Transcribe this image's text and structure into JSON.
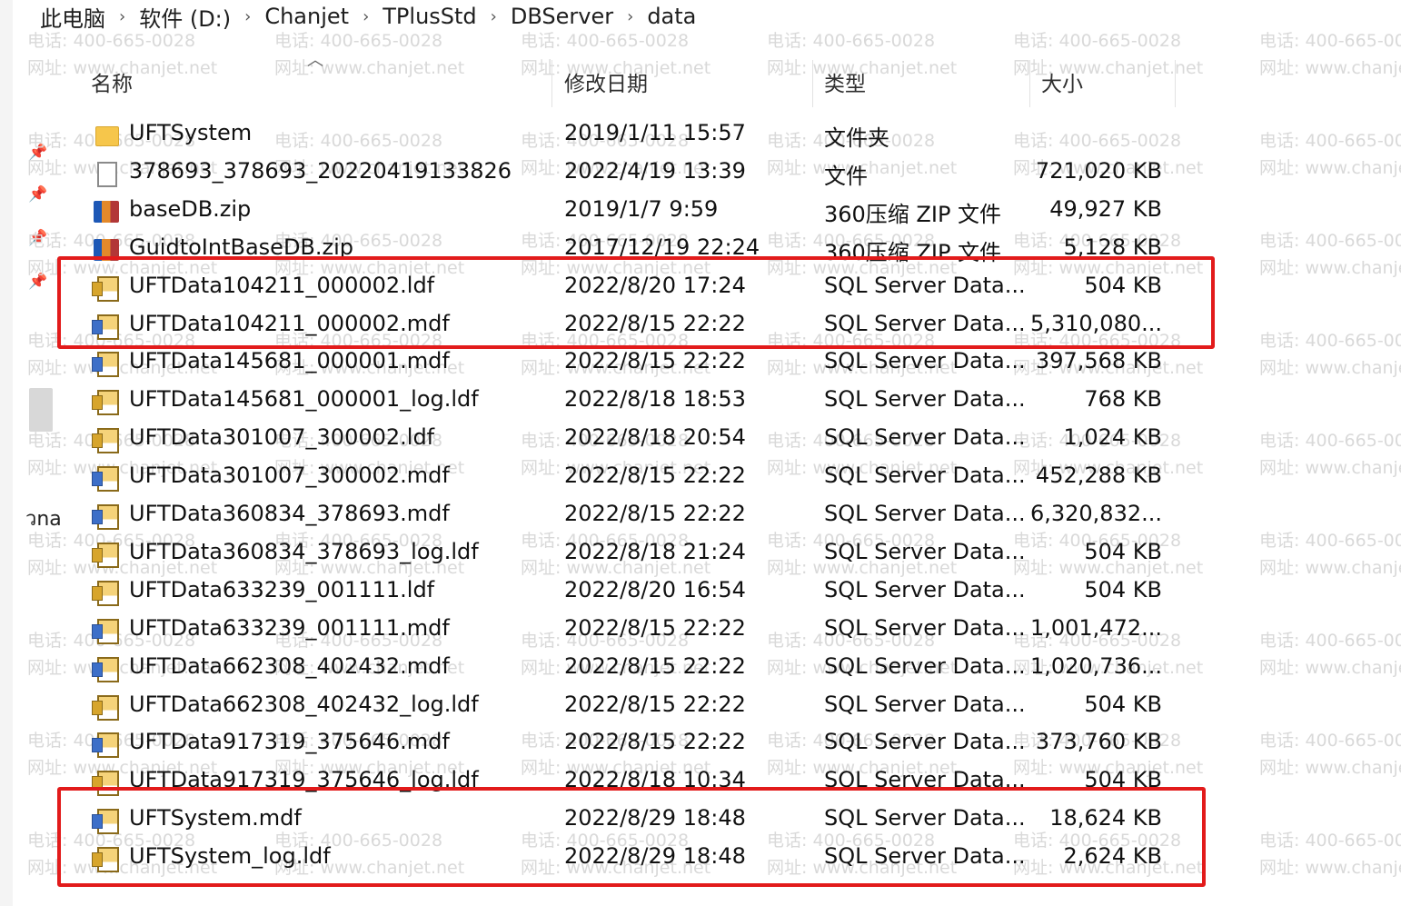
{
  "breadcrumb": [
    "此电脑",
    "软件 (D:)",
    "Chanjet",
    "TPlusStd",
    "DBServer",
    "data"
  ],
  "columns": {
    "name": "名称",
    "date": "修改日期",
    "type": "类型",
    "size": "大小"
  },
  "watermark": {
    "phone": "电话: 400-665-0028",
    "site": "网址: www.chanjet.net"
  },
  "side_text": "วna",
  "files": [
    {
      "icon": "folder-icon",
      "name": "UFTSystem",
      "date": "2019/1/11 15:57",
      "type": "文件夹",
      "size": ""
    },
    {
      "icon": "file-icon",
      "name": "378693_378693_20220419133826",
      "date": "2022/4/19 13:39",
      "type": "文件",
      "size": "721,020 KB"
    },
    {
      "icon": "zip-icon",
      "name": "baseDB.zip",
      "date": "2019/1/7 9:59",
      "type": "360压缩 ZIP 文件",
      "size": "49,927 KB"
    },
    {
      "icon": "zip-icon",
      "name": "GuidtoIntBaseDB.zip",
      "date": "2017/12/19 22:24",
      "type": "360压缩 ZIP 文件",
      "size": "5,128 KB"
    },
    {
      "icon": "ldf-icon",
      "name": "UFTData104211_000002.ldf",
      "date": "2022/8/20 17:24",
      "type": "SQL Server Data...",
      "size": "504 KB"
    },
    {
      "icon": "mdf-icon",
      "name": "UFTData104211_000002.mdf",
      "date": "2022/8/15 22:22",
      "type": "SQL Server Data...",
      "size": "5,310,080..."
    },
    {
      "icon": "mdf-icon",
      "name": "UFTData145681_000001.mdf",
      "date": "2022/8/15 22:22",
      "type": "SQL Server Data...",
      "size": "397,568 KB"
    },
    {
      "icon": "ldf-icon",
      "name": "UFTData145681_000001_log.ldf",
      "date": "2022/8/18 18:53",
      "type": "SQL Server Data...",
      "size": "768 KB"
    },
    {
      "icon": "ldf-icon",
      "name": "UFTData301007_300002.ldf",
      "date": "2022/8/18 20:54",
      "type": "SQL Server Data...",
      "size": "1,024 KB"
    },
    {
      "icon": "mdf-icon",
      "name": "UFTData301007_300002.mdf",
      "date": "2022/8/15 22:22",
      "type": "SQL Server Data...",
      "size": "452,288 KB"
    },
    {
      "icon": "mdf-icon",
      "name": "UFTData360834_378693.mdf",
      "date": "2022/8/15 22:22",
      "type": "SQL Server Data...",
      "size": "6,320,832..."
    },
    {
      "icon": "ldf-icon",
      "name": "UFTData360834_378693_log.ldf",
      "date": "2022/8/18 21:24",
      "type": "SQL Server Data...",
      "size": "504 KB"
    },
    {
      "icon": "ldf-icon",
      "name": "UFTData633239_001111.ldf",
      "date": "2022/8/20 16:54",
      "type": "SQL Server Data...",
      "size": "504 KB"
    },
    {
      "icon": "mdf-icon",
      "name": "UFTData633239_001111.mdf",
      "date": "2022/8/15 22:22",
      "type": "SQL Server Data...",
      "size": "1,001,472..."
    },
    {
      "icon": "mdf-icon",
      "name": "UFTData662308_402432.mdf",
      "date": "2022/8/15 22:22",
      "type": "SQL Server Data...",
      "size": "1,020,736..."
    },
    {
      "icon": "ldf-icon",
      "name": "UFTData662308_402432_log.ldf",
      "date": "2022/8/15 22:22",
      "type": "SQL Server Data...",
      "size": "504 KB"
    },
    {
      "icon": "mdf-icon",
      "name": "UFTData917319_375646.mdf",
      "date": "2022/8/15 22:22",
      "type": "SQL Server Data...",
      "size": "373,760 KB"
    },
    {
      "icon": "ldf-icon",
      "name": "UFTData917319_375646_log.ldf",
      "date": "2022/8/18 10:34",
      "type": "SQL Server Data...",
      "size": "504 KB"
    },
    {
      "icon": "mdf-icon",
      "name": "UFTSystem.mdf",
      "date": "2022/8/29 18:48",
      "type": "SQL Server Data...",
      "size": "18,624 KB"
    },
    {
      "icon": "ldf-icon",
      "name": "UFTSystem_log.ldf",
      "date": "2022/8/29 18:48",
      "type": "SQL Server Data...",
      "size": "2,624 KB"
    }
  ],
  "highlight_color": "#e21b1b"
}
